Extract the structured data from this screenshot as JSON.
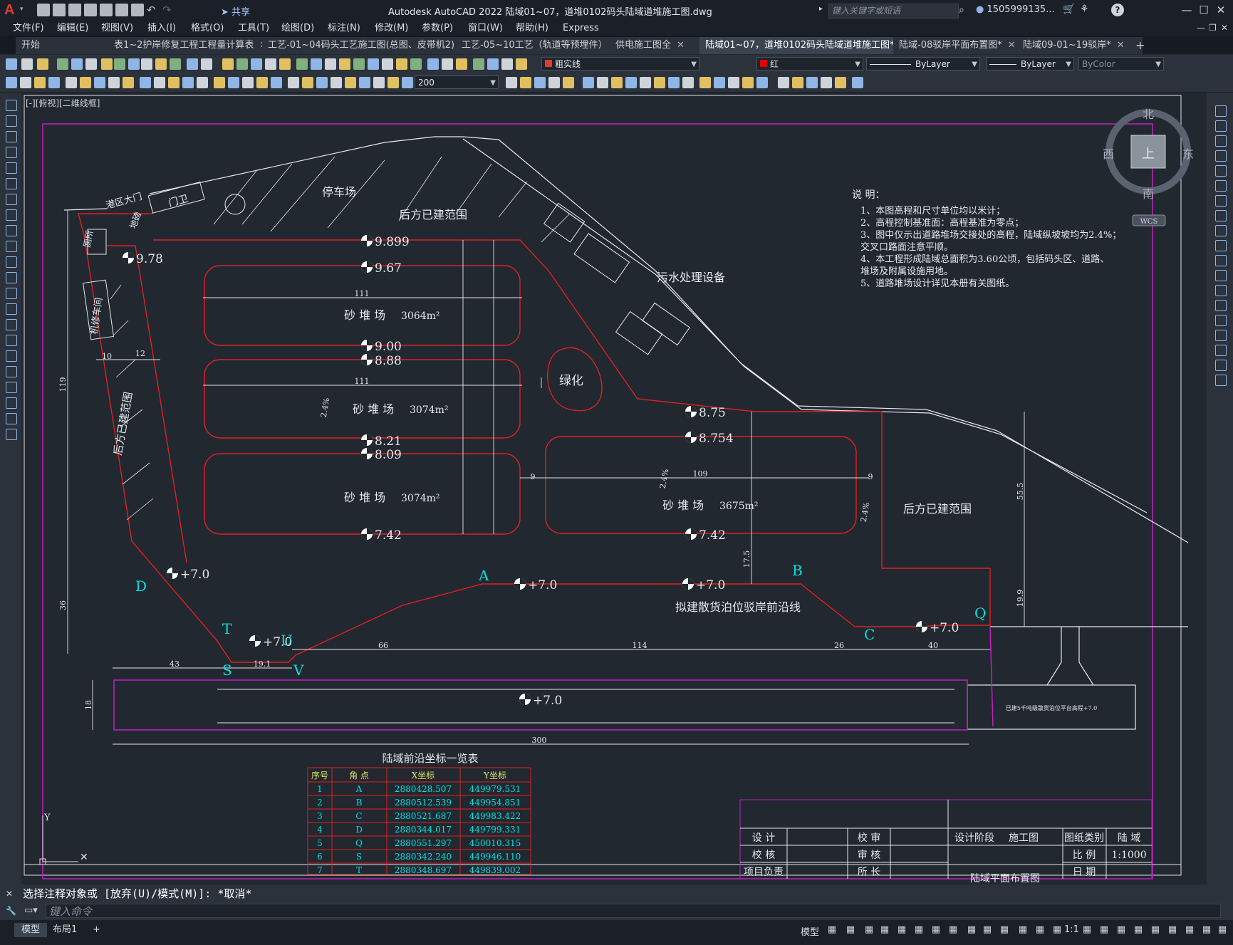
{
  "app": {
    "logo": "A",
    "share_label": "共享",
    "title": "Autodesk AutoCAD 2022    陆域01~07，道堆0102码头陆域道堆施工图.dwg",
    "search_placeholder": "键入关键字或短语",
    "user": "1505999135...",
    "help_label": "?",
    "min_label": "—",
    "max_label": "☐",
    "close_label": "✕"
  },
  "menu": [
    "文件(F)",
    "编辑(E)",
    "视图(V)",
    "插入(I)",
    "格式(O)",
    "工具(T)",
    "绘图(D)",
    "标注(N)",
    "修改(M)",
    "参数(P)",
    "窗口(W)",
    "帮助(H)",
    "Express"
  ],
  "tabs": [
    {
      "label": "开始",
      "active": false
    },
    {
      "label": "表1~2护岸修复工程工程量计算表",
      "active": false
    },
    {
      "label": "工艺-01~04码头工艺施工图(总图、皮带机2)",
      "active": false
    },
    {
      "label": "工艺-05~10工艺（轨道等预埋件）",
      "active": false
    },
    {
      "label": "供电施工图全",
      "active": false
    },
    {
      "label": "陆域01~07，道堆0102码头陆域道堆施工图*",
      "active": true
    },
    {
      "label": "陆域-08驳岸平面布置图*",
      "active": false
    },
    {
      "label": "陆域09-01~19驳岸*",
      "active": false
    }
  ],
  "toolbar1": {
    "layer_dropdown": "粗实线",
    "color_dropdown": "红",
    "linetype_dropdown": "ByLayer",
    "lineweight_dropdown": "ByLayer",
    "plotstyle_dropdown": "ByColor"
  },
  "toolbar2": {
    "scale_dropdown": "200"
  },
  "view_label": "[-][俯视][二维线框]",
  "viewcube": {
    "north": "北",
    "south": "南",
    "east": "东",
    "west": "西",
    "top": "上",
    "wcs": "WCS"
  },
  "drawing": {
    "notes_title": "说 明：",
    "notes": [
      "1、本图高程和尺寸单位均以米计；",
      "2、高程控制基准面：高程基准为零点；",
      "3、图中仅示出道路堆场交接处的高程，陆域纵坡坡均为2.4%；",
      "   交叉口路面注意平顺。",
      "4、本工程形成陆域总面积为3.60公顷，包括码头区、道路、",
      "   堆场及附属设施用地。",
      "5、道路堆场设计详见本册有关图纸。"
    ],
    "labels": {
      "parking": "停车场",
      "built_range_top": "后方已建范围",
      "built_range_left": "后方已建范围",
      "built_range_right": "后方已建范围",
      "gate": "港区大门",
      "guard": "门卫",
      "toilet": "厕所",
      "repair_shop": "机修车间",
      "weigh": "地磅",
      "sewage": "污水处理设备",
      "green": "绿化",
      "proposed_wharf": "拟建散货泊位驳岸前沿线",
      "existing_berth": "已建5千吨级散货泊位平台高程+7.0",
      "table_title": "陆域前沿坐标一览表"
    },
    "yards": [
      {
        "name": "砂 堆 场",
        "area": "3064m²"
      },
      {
        "name": "砂 堆 场",
        "area": "3074m²"
      },
      {
        "name": "砂 堆 场",
        "area": "3074m²"
      },
      {
        "name": "砂 堆 场",
        "area": "3675m²"
      }
    ],
    "elevations": [
      "9.899",
      "9.67",
      "9.00",
      "8.88",
      "8.21",
      "8.09",
      "7.42",
      "9.78",
      "8.75",
      "8.754",
      "7.42",
      "+7.0",
      "+7.0",
      "+7.0",
      "+7.0",
      "+7.0",
      "+7.0"
    ],
    "points": [
      "A",
      "B",
      "C",
      "D",
      "Q",
      "S",
      "T",
      "U",
      "V"
    ],
    "dims": [
      "111",
      "111",
      "109",
      "300",
      "43",
      "19.1",
      "66",
      "114",
      "26",
      "40",
      "119",
      "36",
      "55.5",
      "19.9",
      "17.5",
      "10",
      "12",
      "9",
      "9",
      "18",
      "2.4%",
      "2.4%",
      "2.4%"
    ],
    "coord_table": {
      "headers": [
        "序号",
        "角 点",
        "X坐标",
        "Y坐标"
      ],
      "rows": [
        [
          "1",
          "A",
          "2880428.507",
          "449979.531"
        ],
        [
          "2",
          "B",
          "2880512.539",
          "449954.851"
        ],
        [
          "3",
          "C",
          "2880521.687",
          "449983.422"
        ],
        [
          "4",
          "D",
          "2880344.017",
          "449799.331"
        ],
        [
          "5",
          "Q",
          "2880551.297",
          "450010.315"
        ],
        [
          "6",
          "S",
          "2880342.240",
          "449946.110"
        ],
        [
          "7",
          "T",
          "2880348.697",
          "449839.002"
        ]
      ]
    },
    "title_block": {
      "design": "设 计",
      "check": "校 核",
      "review": "校 审",
      "approve": "审 核",
      "chief": "所 长",
      "project_lead": "项目负责",
      "stage_label": "设计阶段",
      "stage": "施工图",
      "type_label": "图纸类别",
      "type": "陆 域",
      "scale_label": "比 例",
      "scale": "1:1000",
      "date_label": "日 期",
      "drawing_name": "陆域平面布置图"
    }
  },
  "command": {
    "history": "选择注释对象或 [放弃(U)/模式(M)]: *取消*",
    "input_placeholder": "键入命令"
  },
  "status": {
    "model_tab": "模型",
    "layout_tab": "布局1",
    "add_tab": "+",
    "model_label": "模型",
    "scale": "1:1"
  }
}
